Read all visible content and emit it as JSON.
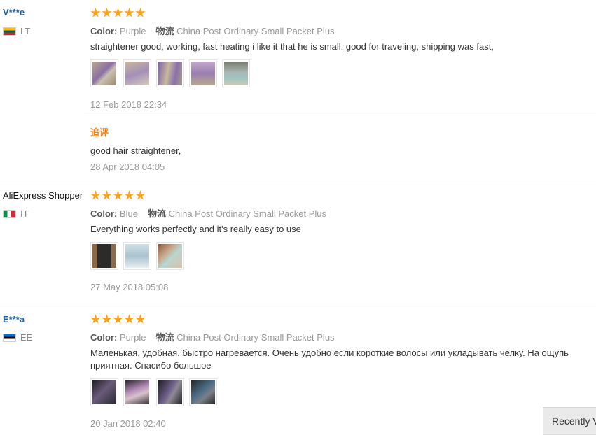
{
  "reviews": [
    {
      "user": "V***e",
      "country": "LT",
      "rating": 5,
      "color_label": "Color:",
      "color_value": "Purple",
      "shipping_label": "物流",
      "shipping_value": "China Post Ordinary Small Packet Plus",
      "text": "straightener good, working, fast heating i like it that he is small, good for traveling, shipping was fast,",
      "date": "12 Feb 2018 22:34",
      "followup": {
        "label": "追评",
        "text": "good hair straightener,",
        "date": "28 Apr 2018 04:05"
      }
    },
    {
      "user": "AliExpress Shopper",
      "country": "IT",
      "rating": 5,
      "color_label": "Color:",
      "color_value": "Blue",
      "shipping_label": "物流",
      "shipping_value": "China Post Ordinary Small Packet Plus",
      "text": "Everything works perfectly and it's really easy to use",
      "date": "27 May 2018 05:08"
    },
    {
      "user": "E***a",
      "country": "EE",
      "rating": 5,
      "color_label": "Color:",
      "color_value": "Purple",
      "shipping_label": "物流",
      "shipping_value": "China Post Ordinary Small Packet Plus",
      "text": "Маленькая, удобная, быстро нагревается. Очень удобно если короткие волосы или укладывать челку. На ощупь приятная. Спасибо большое",
      "date": "20 Jan 2018 02:40"
    }
  ],
  "recently_viewed_label": "Recently V",
  "colors": {
    "star": "#f8a21b",
    "username_link": "#1f63a8",
    "followup_label": "#f0821f"
  }
}
